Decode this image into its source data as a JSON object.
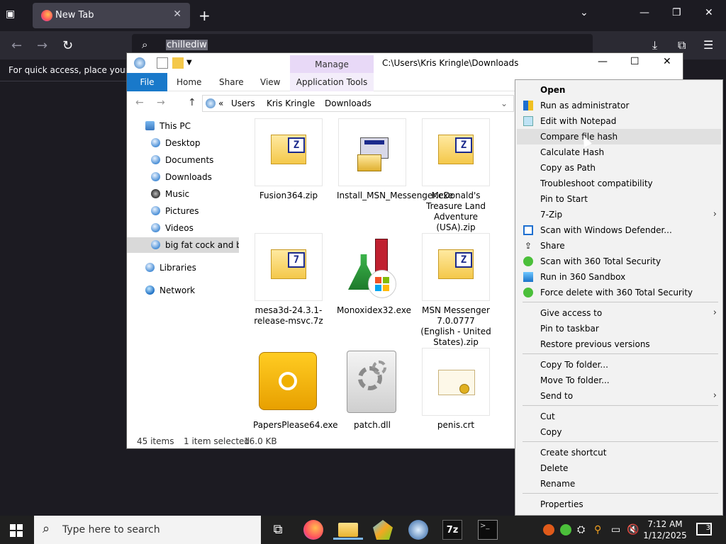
{
  "browser": {
    "tab_title": "New Tab",
    "url_text": "chillediw",
    "bookmarks_hint": "For quick access, place your bo",
    "icons": {
      "tab_list": "tab-list-icon",
      "new_tab": "plus-icon",
      "back": "back-arrow-icon",
      "forward": "forward-arrow-icon",
      "reload": "reload-icon",
      "downloads": "download-icon",
      "extensions": "puzzle-icon",
      "menu": "hamburger-icon"
    }
  },
  "explorer": {
    "manage_label": "Manage",
    "path_title": "C:\\Users\\Kris Kringle\\Downloads",
    "ribbon": {
      "file": "File",
      "home": "Home",
      "share": "Share",
      "view": "View",
      "app_tools": "Application Tools"
    },
    "address": {
      "sep": "«",
      "crumbs": [
        "Users",
        "Kris Kringle",
        "Downloads"
      ]
    },
    "nav": [
      {
        "label": "This PC"
      },
      {
        "label": "Desktop"
      },
      {
        "label": "Documents"
      },
      {
        "label": "Downloads"
      },
      {
        "label": "Music"
      },
      {
        "label": "Pictures"
      },
      {
        "label": "Videos"
      },
      {
        "label": "big fat cock and bal"
      },
      {
        "label": "Libraries"
      },
      {
        "label": "Network"
      }
    ],
    "files": [
      {
        "name": "Fusion364.zip",
        "badge": "Z"
      },
      {
        "name": "Install_MSN_Messenger.exe"
      },
      {
        "name": "McDonald's Treasure Land Adventure (USA).zip",
        "badge": "Z"
      },
      {
        "name": "mesa3d-24.3.1-release-msvc.7z",
        "badge": "7"
      },
      {
        "name": "Monoxidex32.exe"
      },
      {
        "name": "MSN Messenger 7.0.0777 (English - United States).zip",
        "badge": "Z"
      },
      {
        "name": "PapersPlease64.exe"
      },
      {
        "name": "patch.dll"
      },
      {
        "name": "penis.crt"
      }
    ],
    "status": {
      "count": "45 items",
      "selected": "1 item selected",
      "size": "16.0 KB"
    }
  },
  "context_menu": {
    "items": [
      "Open",
      "Run as administrator",
      "Edit with Notepad",
      "Compare file hash",
      "Calculate Hash",
      "Copy as Path",
      "Troubleshoot compatibility",
      "Pin to Start",
      "7-Zip",
      "Scan with Windows Defender...",
      "Share",
      "Scan with 360 Total Security",
      "Run in 360 Sandbox",
      "Force delete with 360 Total Security",
      "Give access to",
      "Pin to taskbar",
      "Restore previous versions",
      "Copy To folder...",
      "Move To folder...",
      "Send to",
      "Cut",
      "Copy",
      "Create shortcut",
      "Delete",
      "Rename",
      "Properties"
    ]
  },
  "taskbar": {
    "search_placeholder": "Type here to search",
    "time": "7:12 AM",
    "date": "1/12/2025",
    "notifications": "3"
  }
}
